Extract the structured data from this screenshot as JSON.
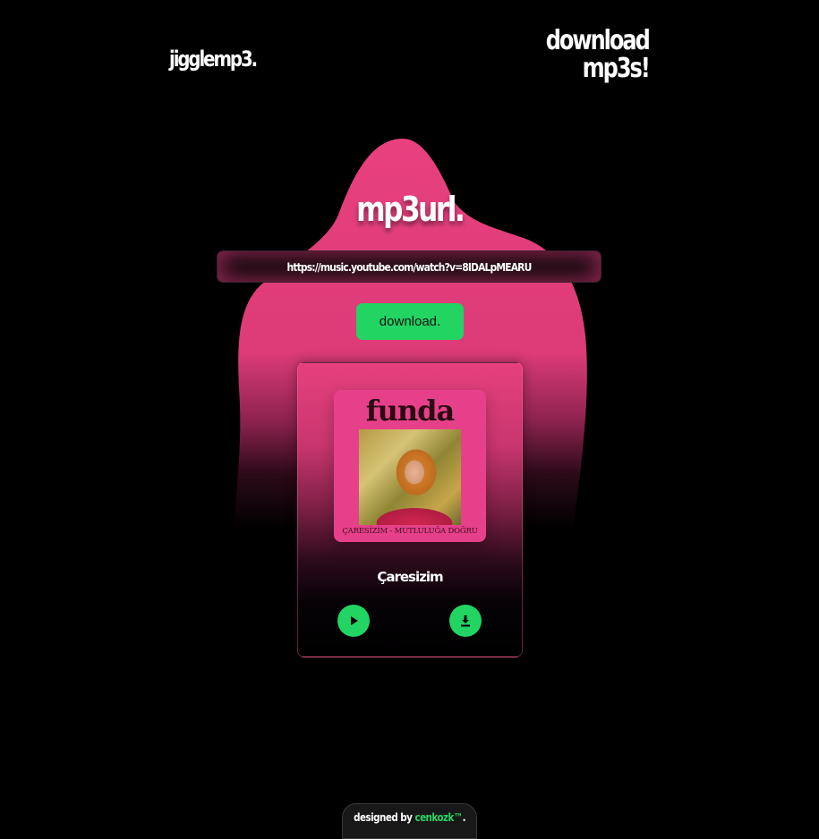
{
  "header": {
    "brand": "jigglemp3.",
    "tagline_line1": "download",
    "tagline_line2": "mp3s!"
  },
  "main": {
    "title": "mp3url.",
    "url_input": {
      "value": "https://music.youtube.com/watch?v=8IDALpMEARU"
    },
    "download_label": "download."
  },
  "result_card": {
    "cover": {
      "artist_text": "funda",
      "caption": "ÇARESİZİM - MUTLULUĞA DOĞRU"
    },
    "track_title": "Çaresizim",
    "play_icon": "play-icon",
    "download_icon": "download-icon"
  },
  "footer": {
    "prefix": "designed by",
    "author": "cenkozk™",
    "suffix": "."
  },
  "colors": {
    "accent_pink": "#e9407f",
    "accent_green": "#22d462",
    "background": "#000000"
  }
}
